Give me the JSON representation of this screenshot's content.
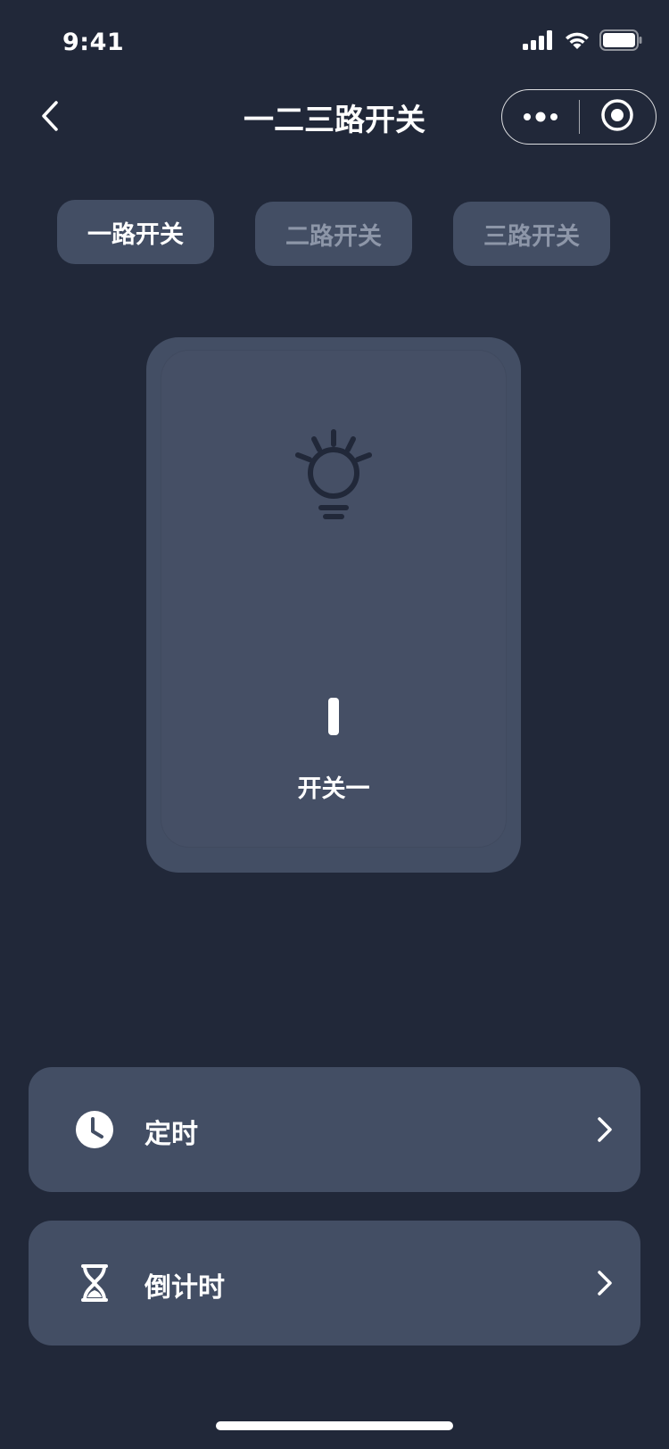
{
  "status_bar": {
    "time": "9:41",
    "icons": [
      "signal-icon",
      "wifi-icon",
      "battery-icon"
    ]
  },
  "nav": {
    "title": "一二三路开关",
    "back_icon": "chevron-left-icon",
    "more_icon": "more-dots-icon",
    "close_icon": "target-circle-icon"
  },
  "tabs": [
    {
      "label": "一路开关",
      "active": true
    },
    {
      "label": "二路开关",
      "active": false
    },
    {
      "label": "三路开关",
      "active": false
    }
  ],
  "switch": {
    "label": "开关一",
    "icon": "lightbulb-icon",
    "state": "on"
  },
  "menu": [
    {
      "label": "定时",
      "icon": "clock-icon"
    },
    {
      "label": "倒计时",
      "icon": "hourglass-icon"
    }
  ],
  "colors": {
    "background": "#212839",
    "card": "#434e64",
    "inactive_text": "#8d96a8",
    "bulb": "#212839"
  }
}
